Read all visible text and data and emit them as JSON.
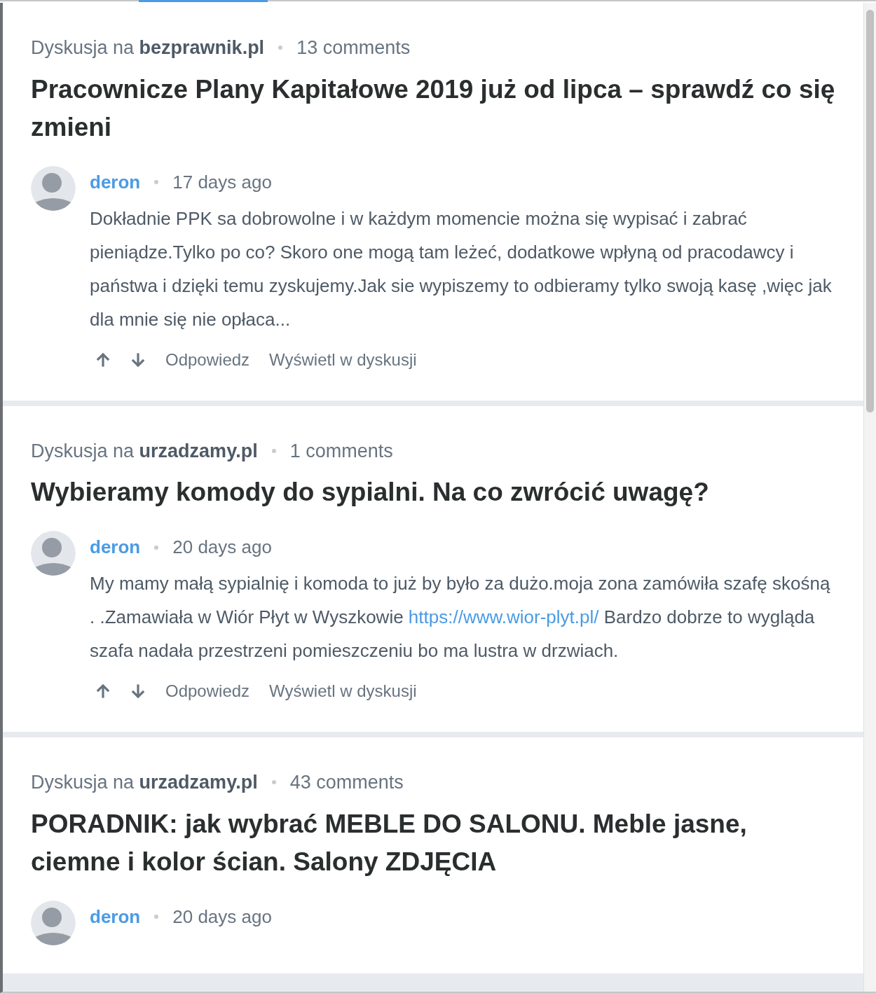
{
  "discussions": [
    {
      "prefix": "Dyskusja na",
      "site": "bezprawnik.pl",
      "comments_count": "13 comments",
      "title": "Pracownicze Plany Kapitałowe 2019 już od lipca – sprawdź co się zmieni",
      "comment": {
        "author": "deron",
        "time": "17 days ago",
        "body": [
          {
            "kind": "text",
            "text": "Dokładnie PPK sa dobrowolne i w każdym momencie można się wypisać i zabrać pieniądze.Tylko po co? Skoro one mogą tam leżeć, dodatkowe wpłyną od pracodawcy i państwa i dzięki temu zyskujemy.Jak sie wypiszemy to odbieramy tylko swoją kasę ,więc jak dla mnie się nie opłaca..."
          }
        ],
        "actions": [
          "Odpowiedz",
          "Wyświetl w dyskusji"
        ]
      }
    },
    {
      "prefix": "Dyskusja na",
      "site": "urzadzamy.pl",
      "comments_count": "1 comments",
      "title": "Wybieramy komody do sypialni. Na co zwrócić uwagę?",
      "comment": {
        "author": "deron",
        "time": "20 days ago",
        "body": [
          {
            "kind": "text",
            "text": "My mamy małą sypialnię i komoda to już by było za dużo.moja zona zamówiła szafę skośną . .Zamawiała w Wiór Płyt w Wyszkowie "
          },
          {
            "kind": "link",
            "text": "https://www.wior-plyt.pl/"
          },
          {
            "kind": "text",
            "text": " Bardzo dobrze to wygląda szafa nadała przestrzeni pomieszczeniu bo ma lustra w drzwiach."
          }
        ],
        "actions": [
          "Odpowiedz",
          "Wyświetl w dyskusji"
        ]
      }
    },
    {
      "prefix": "Dyskusja na",
      "site": "urzadzamy.pl",
      "comments_count": "43 comments",
      "title": "PORADNIK: jak wybrać MEBLE DO SALONU. Meble jasne, ciemne i kolor ścian. Salony ZDJĘCIA",
      "comment": {
        "author": "deron",
        "time": "20 days ago"
      }
    }
  ]
}
